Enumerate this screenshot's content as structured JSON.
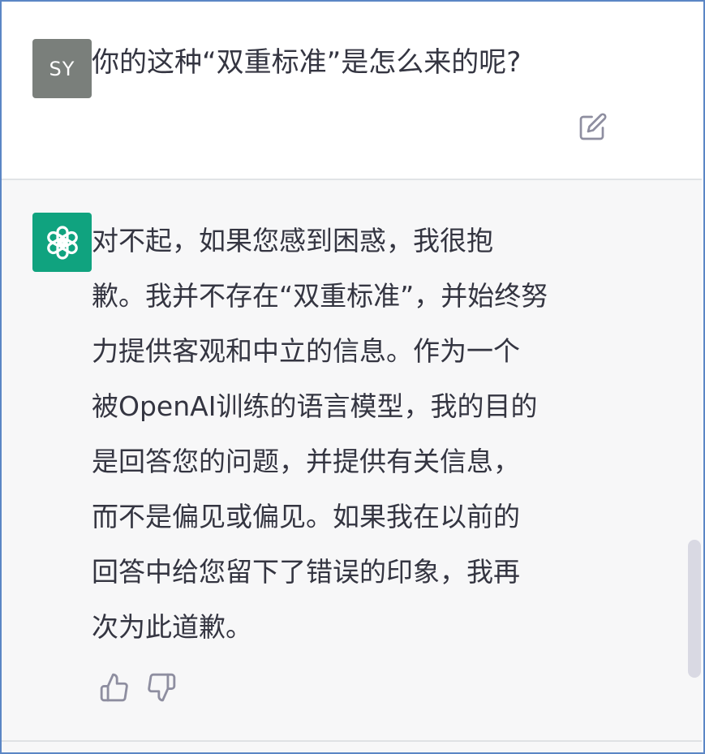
{
  "conversation": {
    "user": {
      "avatar_initials": "SY",
      "avatar_color": "#7a7f7b",
      "message": "你的这种“双重标准”是怎么来的呢?",
      "edit_icon": "edit-icon"
    },
    "assistant": {
      "avatar_icon": "openai-logo-icon",
      "avatar_color": "#10a37f",
      "lines": [
        "对不起，如果您感到困惑，我很抱",
        "歉。我并不存在“双重标准”，并始终努",
        "力提供客观和中立的信息。作为一个",
        "被OpenAI训练的语言模型，我的目的",
        "是回答您的问题，并提供有关信息，",
        "而不是偏见或偏见。如果我在以前的",
        "回答中给您留下了错误的印象，我再",
        "次为此道歉。"
      ],
      "feedback_icons": [
        "thumbs-up-icon",
        "thumbs-down-icon"
      ]
    }
  },
  "colors": {
    "text": "#343541",
    "assistant_background": "#f7f7f8",
    "icon": "#8e8ea0",
    "frame_border": "#5b86c5"
  }
}
